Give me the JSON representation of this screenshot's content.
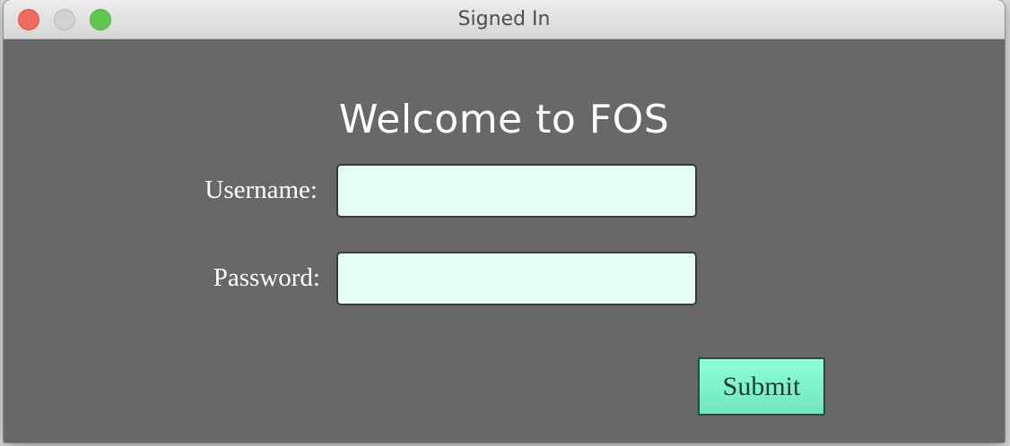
{
  "window": {
    "title": "Signed In"
  },
  "form": {
    "heading": "Welcome to FOS",
    "username_label": "Username:",
    "username_value": "",
    "username_placeholder": "",
    "password_label": "Password:",
    "password_value": "",
    "password_placeholder": "",
    "submit_label": "Submit"
  },
  "colors": {
    "background": "#686868",
    "input_background": "#e6fff5",
    "submit_background": "#7ff5cc",
    "text": "#ffffff"
  }
}
